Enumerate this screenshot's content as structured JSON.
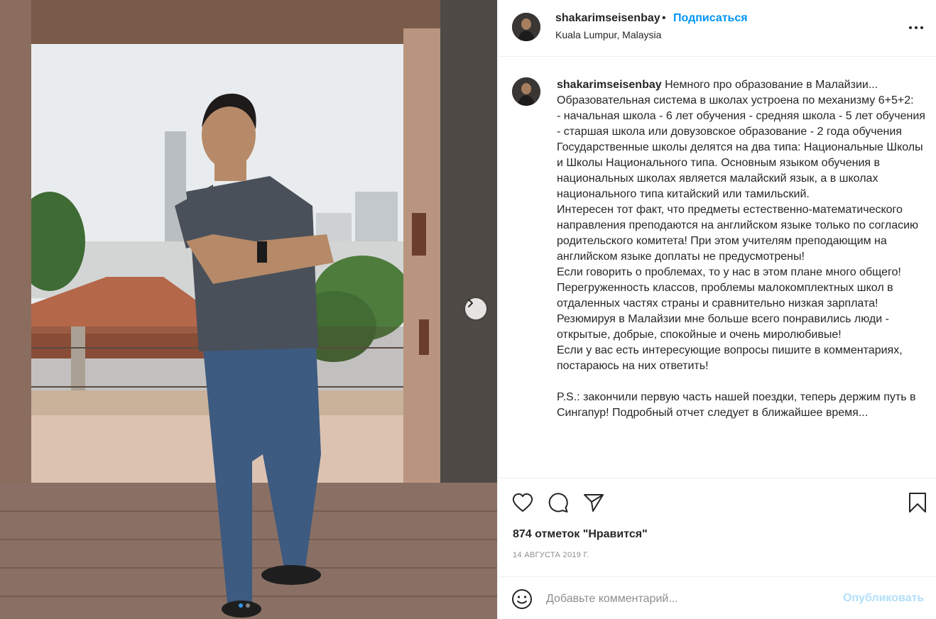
{
  "post": {
    "username": "shakarimseisenbay",
    "separator": "•",
    "follow_label": "Подписаться",
    "location": "Kuala Lumpur, Malaysia",
    "more_icon": "more-horizontal-icon"
  },
  "caption": {
    "username": "shakarimseisenbay",
    "text": " Немного про образование в Малайзии...\nОбразовательная система в школах устроена по механизму 6+5+2:\n- начальная школа - 6 лет обучения - средняя школа - 5 лет обучения - старшая школа или довузовское образование - 2 года обучения\nГосударственные школы делятся на два типа: Национальные Школы и Школы Национального типа. Основным языком обучения в национальных школах является малайский язык, а в школах национального типа китайский или тамильский.\nИнтересен тот факт, что предметы естественно-математического направления преподаются на английском языке только по согласию родительского комитета! При этом учителям преподающим на английском языке доплаты не предусмотрены!\nЕсли говорить о проблемах, то у нас в этом плане много общего! Перегруженность классов, проблемы малокомплектных школ в отдаленных частях страны и сравнительно низкая зарплата!\nРезюмируя в Малайзии мне больше всего понравились люди - открытые, добрые, спокойные и очень миролюбивые!\nЕсли у вас есть интересующие вопросы пишите в комментариях, постараюсь на них ответить!\n\nP.S.: закончили первую часть нашей поездки, теперь держим путь в Сингапур! Подробный отчет следует в ближайшее время..."
  },
  "actions": {
    "like_icon": "heart-icon",
    "comment_icon": "comment-icon",
    "share_icon": "paper-plane-icon",
    "save_icon": "bookmark-icon"
  },
  "likes_text": "874 отметок \"Нравится\"",
  "date_text": "14 АВГУСТА 2019 Г.",
  "comment": {
    "placeholder": "Добавьте комментарий...",
    "publish_label": "Опубликовать",
    "emoji_icon": "smiley-icon"
  },
  "carousel": {
    "total": 2,
    "active_index": 0,
    "next_icon": "chevron-right-icon"
  },
  "colors": {
    "link_blue": "#0095f6",
    "publish_disabled": "#b2dffc",
    "muted": "#8e8e8e",
    "text": "#262626",
    "border": "#efefef"
  }
}
